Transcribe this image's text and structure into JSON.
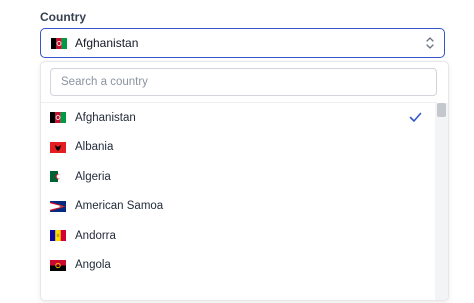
{
  "field": {
    "label": "Country",
    "selected": "Afghanistan"
  },
  "dropdown": {
    "search_placeholder": "Search a country",
    "items": [
      {
        "name": "Afghanistan",
        "flag": "afghanistan-flag-icon",
        "selected": true
      },
      {
        "name": "Albania",
        "flag": "albania-flag-icon",
        "selected": false
      },
      {
        "name": "Algeria",
        "flag": "algeria-flag-icon",
        "selected": false
      },
      {
        "name": "American Samoa",
        "flag": "american-samoa-flag-icon",
        "selected": false
      },
      {
        "name": "Andorra",
        "flag": "andorra-flag-icon",
        "selected": false
      },
      {
        "name": "Angola",
        "flag": "angola-flag-icon",
        "selected": false
      }
    ]
  },
  "colors": {
    "focus_border": "#3557c9",
    "check": "#3557c9"
  }
}
